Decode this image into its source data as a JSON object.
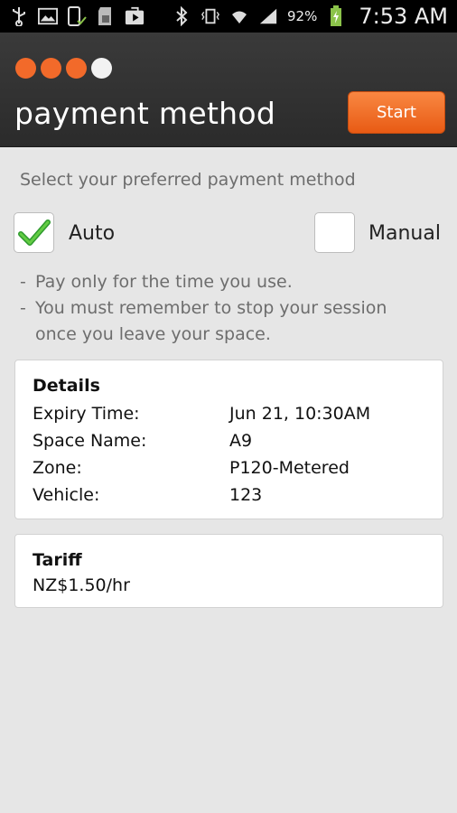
{
  "status_bar": {
    "battery_percent": "92%",
    "time": "7:53 AM",
    "icons_left": [
      "usb-icon",
      "image-icon",
      "phone-check-icon",
      "sd-card-icon",
      "play-store-icon"
    ],
    "icons_right": [
      "bluetooth-icon",
      "vibrate-icon",
      "wifi-icon",
      "signal-icon",
      "battery-charging-icon"
    ]
  },
  "header": {
    "title": "payment method",
    "start_label": "Start",
    "progress_steps_total": 4,
    "progress_steps_active": 3,
    "accent_color": "#f26a2a"
  },
  "instruction": "Select your preferred payment method",
  "options": {
    "auto": {
      "label": "Auto",
      "checked": true
    },
    "manual": {
      "label": "Manual",
      "checked": false
    }
  },
  "notes": [
    {
      "bullet": "-",
      "text": "Pay only for the time you use."
    },
    {
      "bullet": "-",
      "text": "You must remember to stop your session once you leave your space."
    }
  ],
  "details": {
    "title": "Details",
    "rows": [
      {
        "label": "Expiry Time:",
        "value": "Jun 21, 10:30AM"
      },
      {
        "label": "Space Name:",
        "value": "A9"
      },
      {
        "label": "Zone:",
        "value": "P120-Metered"
      },
      {
        "label": "Vehicle:",
        "value": "123"
      }
    ]
  },
  "tariff": {
    "title": "Tariff",
    "value": "NZ$1.50/hr"
  }
}
